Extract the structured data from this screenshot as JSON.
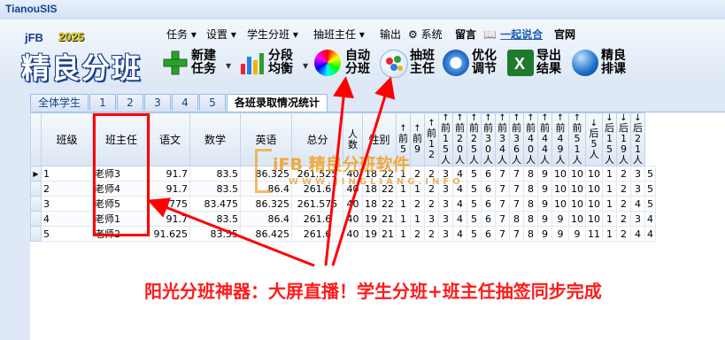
{
  "window": {
    "title": "TianouSIS"
  },
  "brand": {
    "prefix": "jFB",
    "year": "2025",
    "name": "精良分班"
  },
  "menu": [
    "任务",
    "设置",
    "学生分班",
    "抽班主任",
    "输出",
    "系统",
    "留言",
    "一起说合",
    "官网"
  ],
  "toolbar": [
    {
      "line1": "新建",
      "line2": "任务",
      "icon": "plus-icon"
    },
    {
      "line1": "分段",
      "line2": "均衡",
      "icon": "bar-chart-icon"
    },
    {
      "line1": "自动",
      "line2": "分班",
      "icon": "color-wheel-icon"
    },
    {
      "line1": "抽班",
      "line2": "主任",
      "icon": "lottery-icon"
    },
    {
      "line1": "优化",
      "line2": "调节",
      "icon": "optimize-icon"
    },
    {
      "line1": "导出",
      "line2": "结果",
      "icon": "excel-icon"
    },
    {
      "line1": "精良",
      "line2": "排课",
      "icon": "globe-icon"
    }
  ],
  "tabs": [
    "全体学生",
    "1",
    "2",
    "3",
    "4",
    "5",
    "各班录取情况统计"
  ],
  "table": {
    "headers": [
      "班级",
      "班主任",
      "语文",
      "数学",
      "英语",
      "总分",
      "人数",
      "性别"
    ],
    "range_headers": [
      "前5",
      "前9",
      "前12",
      "前15人",
      "前20人",
      "前25人",
      "前30人",
      "前34人",
      "前36人",
      "前40人",
      "前44人",
      "前49人",
      "前51人",
      "后5人",
      "后15人",
      "后19人",
      "后21人"
    ],
    "rows": [
      [
        "1",
        "老师3",
        "91.7",
        "83.5",
        "86.325",
        "261.525",
        "40",
        "18",
        "22",
        "1",
        "2",
        "2",
        "3",
        "4",
        "5",
        "6",
        "7",
        "7",
        "8",
        "9",
        "10",
        "10",
        "10",
        "1",
        "2",
        "3",
        "5"
      ],
      [
        "2",
        "老师4",
        "91.7",
        "83.5",
        "86.4",
        "261.6",
        "40",
        "18",
        "22",
        "1",
        "1",
        "2",
        "3",
        "4",
        "5",
        "6",
        "7",
        "7",
        "8",
        "9",
        "10",
        "10",
        "10",
        "1",
        "2",
        "3",
        "5"
      ],
      [
        "3",
        "老师5",
        "91.775",
        "83.475",
        "86.325",
        "261.575",
        "40",
        "18",
        "22",
        "1",
        "2",
        "2",
        "3",
        "4",
        "5",
        "6",
        "7",
        "7",
        "8",
        "9",
        "10",
        "10",
        "10",
        "1",
        "2",
        "4",
        "5"
      ],
      [
        "4",
        "老师1",
        "91.7",
        "83.5",
        "86.4",
        "261.6",
        "40",
        "19",
        "21",
        "1",
        "1",
        "3",
        "3",
        "4",
        "5",
        "6",
        "7",
        "8",
        "8",
        "9",
        "9",
        "10",
        "10",
        "1",
        "2",
        "3",
        "4"
      ],
      [
        "5",
        "老师2",
        "91.625",
        "83.55",
        "86.425",
        "261.6",
        "40",
        "19",
        "21",
        "1",
        "2",
        "2",
        "3",
        "4",
        "5",
        "6",
        "7",
        "7",
        "8",
        "9",
        "9",
        "9",
        "11",
        "1",
        "2",
        "4",
        "4"
      ]
    ]
  },
  "watermark": {
    "line1": "iFB 精良分班软件",
    "line2": "WWW.JINGLIANG.INFO"
  },
  "caption": "阳光分班神器：大屏直播！学生分班+班主任抽签同步完成",
  "colors": {
    "annotation": "#ff0000",
    "accent": "#15428b"
  }
}
